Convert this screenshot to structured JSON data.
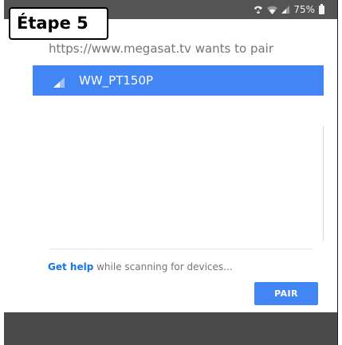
{
  "status_bar": {
    "icons": [
      "call-forward-icon",
      "wifi-icon",
      "cell-signal-icon"
    ],
    "battery_text": "75%"
  },
  "dialog": {
    "title": "https://www.megasat.tv wants to pair",
    "devices": [
      {
        "name": "WW_PT150P",
        "selected": true,
        "icon": "signal-strength-icon"
      }
    ],
    "help_link": "Get help",
    "help_text": " while scanning for devices...",
    "pair_button": "PAIR"
  },
  "overlay": {
    "step_label": "Étape 5"
  },
  "colors": {
    "accent": "#4285f4",
    "status_bar": "#545454",
    "nav_bar": "#4a4a4a",
    "link": "#1a73e8",
    "muted_text": "#757575"
  }
}
